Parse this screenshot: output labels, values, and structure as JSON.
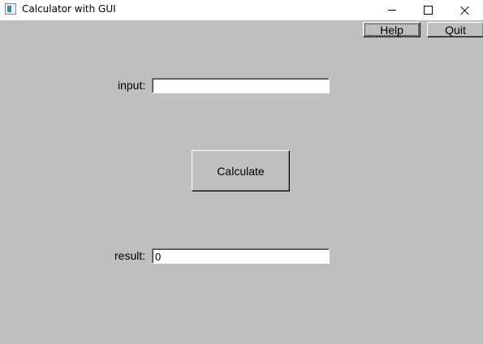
{
  "window": {
    "title": "Calculator with GUI",
    "icon": "app-window-icon"
  },
  "toolbar": {
    "help_label": "Help",
    "quit_label": "Quit"
  },
  "form": {
    "input_label": "input:",
    "input_value": "",
    "calculate_label": "Calculate",
    "result_label": "result:",
    "result_value": "0"
  },
  "colors": {
    "background": "#bfbfbf",
    "titlebar": "#ffffff"
  }
}
